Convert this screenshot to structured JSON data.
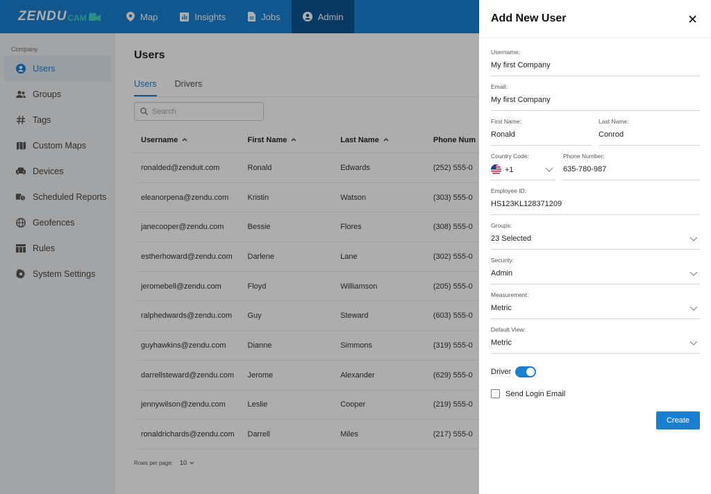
{
  "brand": {
    "logo_main": "ZENDU",
    "logo_sub": "CAM"
  },
  "nav": [
    {
      "label": "Map",
      "icon": "map-pin-icon"
    },
    {
      "label": "Insights",
      "icon": "insights-icon"
    },
    {
      "label": "Jobs",
      "icon": "document-icon"
    },
    {
      "label": "Admin",
      "icon": "user-circle-icon",
      "active": true
    }
  ],
  "sidebar": {
    "section": "Company",
    "items": [
      {
        "label": "Users",
        "icon": "user-circle-icon",
        "active": true
      },
      {
        "label": "Groups",
        "icon": "groups-icon"
      },
      {
        "label": "Tags",
        "icon": "hash-icon"
      },
      {
        "label": "Custom Maps",
        "icon": "map-icon"
      },
      {
        "label": "Devices",
        "icon": "car-icon"
      },
      {
        "label": "Scheduled Reports",
        "icon": "scheduled-report-icon"
      },
      {
        "label": "Geofences",
        "icon": "globe-icon"
      },
      {
        "label": "Rules",
        "icon": "table-icon"
      },
      {
        "label": "System Settings",
        "icon": "gear-icon"
      }
    ]
  },
  "main": {
    "title": "Users",
    "tabs": [
      "Users",
      "Drivers"
    ],
    "search_placeholder": "Search",
    "columns": [
      "Username",
      "First Name",
      "Last Name",
      "Phone Num"
    ],
    "rows": [
      [
        "ronalded@zenduit.com",
        "Ronald",
        "Edwards",
        "(252) 555-0"
      ],
      [
        "eleanorpena@zendu.com",
        "Kristin",
        "Watson",
        "(303) 555-0"
      ],
      [
        "janecooper@zendu.com",
        "Bessie",
        "Flores",
        "(308) 555-0"
      ],
      [
        "estherhoward@zendu.com",
        "Darlene",
        "Lane",
        "(302) 555-0"
      ],
      [
        "jeromebell@zendu.com",
        "Floyd",
        "Williamson",
        "(205) 555-0"
      ],
      [
        "ralphedwards@zendu.com",
        "Guy",
        "Steward",
        "(603) 555-0"
      ],
      [
        "guyhawkins@zendu.com",
        "Dianne",
        "Simmons",
        "(319) 555-0"
      ],
      [
        "darrellsteward@zendu.com",
        "Jerome",
        "Alexander",
        "(629) 555-0"
      ],
      [
        "jennywilson@zendu.com",
        "Leslie",
        "Cooper",
        "(219) 555-0"
      ],
      [
        "ronaldrichards@zendu.com",
        "Darrell",
        "Miles",
        "(217) 555-0"
      ]
    ],
    "rows_per_page_label": "Rows per page:",
    "rows_per_page_value": "10"
  },
  "drawer": {
    "title": "Add New User",
    "username_label": "Username:",
    "username_value": "My first Company",
    "email_label": "Email:",
    "email_value": "My first Company",
    "first_name_label": "First Name:",
    "first_name_value": "Ronald",
    "last_name_label": "Last Name:",
    "last_name_value": "Conrod",
    "country_code_label": "Country Code:",
    "country_code_value": "+1",
    "phone_label": "Phone Number:",
    "phone_value": "635-780-987",
    "employee_id_label": "Employee ID:",
    "employee_id_value": "HS123KL128371209",
    "groups_label": "Groups:",
    "groups_value": "23 Selected",
    "security_label": "Security:",
    "security_value": "Admin",
    "measurement_label": "Measurement:",
    "measurement_value": "Metric",
    "default_view_label": "Default View:",
    "default_view_value": "Metric",
    "driver_label": "Driver",
    "driver_on": true,
    "send_login_label": "Send Login Email",
    "send_login_checked": false,
    "create_label": "Create"
  },
  "colors": {
    "primary": "#1a7fd0",
    "nav_active": "#0d5594",
    "accent_teal": "#3fd3c4"
  }
}
